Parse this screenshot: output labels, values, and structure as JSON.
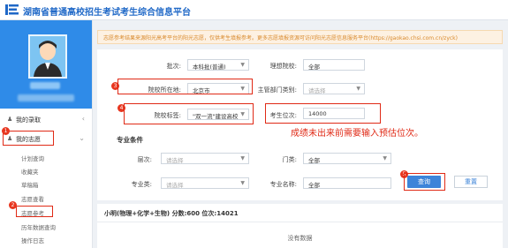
{
  "header": {
    "title": "湖南省普通高校招生考试考生综合信息平台"
  },
  "sidebar": {
    "items": [
      {
        "label": "我的录取"
      },
      {
        "label": "我的志愿"
      }
    ],
    "subitems": [
      "计划查询",
      "收藏夹",
      "草稿箱",
      "志愿查看",
      "志愿参考",
      "历年数据查询",
      "操作日志"
    ]
  },
  "markers": [
    "1",
    "2",
    "3",
    "4",
    "5"
  ],
  "notice": {
    "text": "志愿参考结果来源阳光高考平台的阳光志愿，仅供考生填报参考。更多志愿填报资源可访问阳光志愿信息服务平台(https://gaokao.chsi.com.cn/zyck)"
  },
  "form": {
    "batch_label": "批次:",
    "batch_value": "本科批(普通)",
    "subject_label": "理想院校:",
    "subject_value": "全部",
    "location_label": "院校所在地:",
    "location_value": "北京市",
    "dept_label": "主管部门类别:",
    "dept_value": "请选择",
    "tag_label": "院校标签:",
    "tag_value": "\"双一流\"建设高校",
    "rank_label": "考生位次:",
    "rank_value": "14000",
    "section_title": "专业条件",
    "level_label": "层次:",
    "level_value": "请选择",
    "category_label": "门类:",
    "category_value": "全部",
    "major_class_label": "专业类:",
    "major_class_value": "请选择",
    "major_name_label": "专业名称:",
    "major_name_value": "全部",
    "query_label": "查询",
    "reset_label": "重置"
  },
  "annotation": "成绩未出来前需要输入预估位次。",
  "result": {
    "summary": "小明(物理+化学+生物) 分数:600 位次:14021",
    "empty": "没有数据"
  }
}
